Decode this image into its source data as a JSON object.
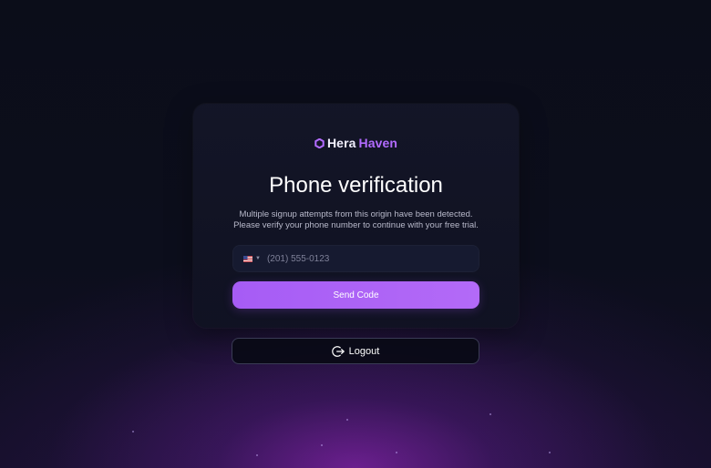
{
  "brand": {
    "name_part1": "Hera",
    "name_part2": "Haven",
    "logo_icon": "hexagon-ring-icon",
    "accent_color": "#b26bff"
  },
  "verification": {
    "title": "Phone verification",
    "message": "Multiple signup attempts from this origin have been detected. Please verify your phone number to continue with your free trial."
  },
  "phone": {
    "country_flag_icon": "us-flag-icon",
    "dropdown_icon": "chevron-down-icon",
    "value": "",
    "placeholder": "(201) 555-0123"
  },
  "actions": {
    "send_code_label": "Send Code",
    "send_code_color": "#a65cf5",
    "logout_label": "Logout",
    "logout_icon": "logout-icon"
  }
}
